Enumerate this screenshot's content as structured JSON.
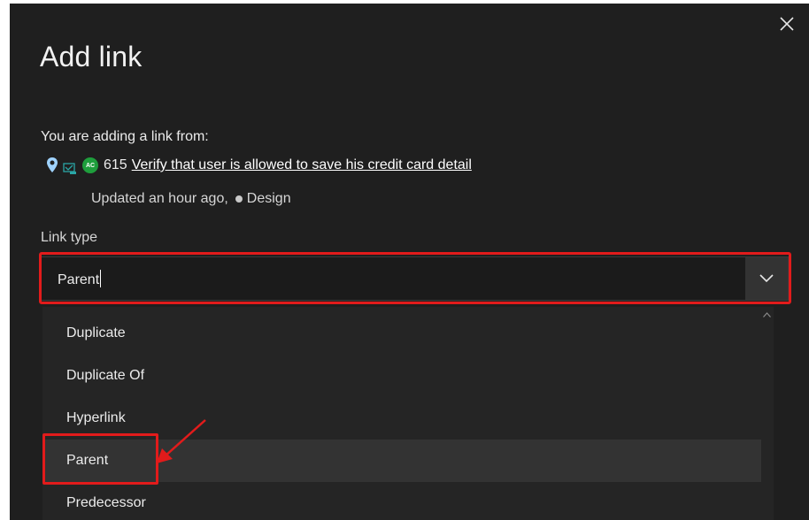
{
  "dialog": {
    "title": "Add link",
    "close_icon": "close-icon"
  },
  "source": {
    "label": "You are adding a link from:",
    "icons": [
      "pin-icon",
      "test-case-icon"
    ],
    "avatar_initials": "AC",
    "avatar_color": "#1e9e3c",
    "id": "615",
    "title": "Verify that user is allowed to save his credit card detail",
    "updated": "Updated an hour ago,",
    "state": "Design"
  },
  "link_type": {
    "label": "Link type",
    "value": "Parent",
    "chevron_icon": "chevron-down-icon"
  },
  "dropdown": {
    "options": [
      "Duplicate",
      "Duplicate Of",
      "Hyperlink",
      "Parent",
      "Predecessor"
    ],
    "selected": "Parent"
  },
  "annotations": {
    "highlight_color": "#e21b1b"
  }
}
